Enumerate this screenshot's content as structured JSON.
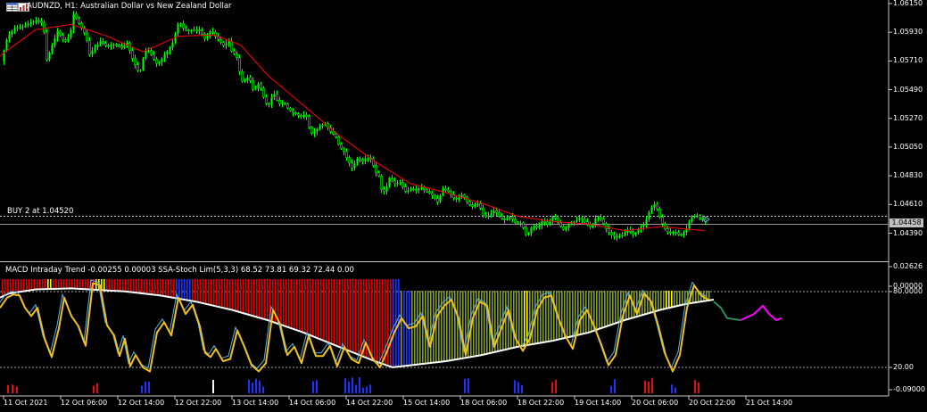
{
  "header": {
    "symbol": "AUDNZD",
    "timeframe": "H1",
    "description": "Australian Dollar vs New Zealand Dollar",
    "text": "AUDNZD, H1:  Australian Dollar vs New Zealand Dollar"
  },
  "icons": {
    "left": "grid-icon",
    "right": "chart-bars-icon"
  },
  "order_line": {
    "label": "BUY 2 at 1.04520",
    "price": 1.0452
  },
  "current_price": {
    "label": "1.04458",
    "value": 1.04458
  },
  "indicator": {
    "title": "MACD Intraday Trend -0.00255 0.00003 SSA-Stoch Lim(5,3,3) 68.52 73.81 69.32 72.44 0.00"
  },
  "colors": {
    "background": "#000000",
    "bull_candle": "#00ff00",
    "moving_average": "#ff0000",
    "hist_bearish": "#e00000",
    "hist_bullish": "#7f9a2e",
    "hist_neutral_yellow": "#ffff00",
    "hist_blue": "#1e32ff",
    "stoch_main": "#f0c020",
    "stoch_signal": "#5ab4e6",
    "trend_line": "#ffffff",
    "forecast_magenta": "#ff00ff",
    "forecast_green": "#2e8b57",
    "grid_dashed": "#aaaaaa"
  },
  "chart_data": [
    {
      "type": "candlestick",
      "title": "AUDNZD, H1",
      "price_axis_ticks": [
        "1.06150",
        "1.05930",
        "1.05710",
        "1.05490",
        "1.05270",
        "1.05050",
        "1.04830",
        "1.04610",
        "1.04390"
      ],
      "ylim": [
        1.0425,
        1.0615
      ],
      "time_axis_ticks": [
        "11 Oct 2021",
        "12 Oct 06:00",
        "12 Oct 14:00",
        "12 Oct 22:00",
        "13 Oct 14:00",
        "14 Oct 06:00",
        "14 Oct 22:00",
        "15 Oct 14:00",
        "18 Oct 06:00",
        "18 Oct 22:00",
        "19 Oct 14:00",
        "20 Oct 06:00",
        "20 Oct 22:00",
        "21 Oct 14:00"
      ],
      "close_path": [
        [
          0,
          1.0568
        ],
        [
          8,
          1.059
        ],
        [
          16,
          1.0596
        ],
        [
          24,
          1.0597
        ],
        [
          32,
          1.06
        ],
        [
          40,
          1.0602
        ],
        [
          48,
          1.06
        ],
        [
          52,
          1.0572
        ],
        [
          58,
          1.0583
        ],
        [
          64,
          1.0594
        ],
        [
          72,
          1.0585
        ],
        [
          78,
          1.0591
        ],
        [
          82,
          1.0607
        ],
        [
          88,
          1.06
        ],
        [
          96,
          1.059
        ],
        [
          100,
          1.0576
        ],
        [
          104,
          1.058
        ],
        [
          112,
          1.0586
        ],
        [
          120,
          1.0582
        ],
        [
          128,
          1.0584
        ],
        [
          136,
          1.0581
        ],
        [
          142,
          1.0585
        ],
        [
          148,
          1.0573
        ],
        [
          151,
          1.0568
        ],
        [
          156,
          1.0561
        ],
        [
          160,
          1.0573
        ],
        [
          164,
          1.0581
        ],
        [
          168,
          1.0577
        ],
        [
          176,
          1.0568
        ],
        [
          184,
          1.0576
        ],
        [
          192,
          1.0583
        ],
        [
          196,
          1.0592
        ],
        [
          200,
          1.0602
        ],
        [
          206,
          1.0595
        ],
        [
          212,
          1.0594
        ],
        [
          218,
          1.0595
        ],
        [
          224,
          1.0594
        ],
        [
          230,
          1.0587
        ],
        [
          236,
          1.0595
        ],
        [
          242,
          1.0589
        ],
        [
          250,
          1.0583
        ],
        [
          256,
          1.0586
        ],
        [
          260,
          1.0576
        ],
        [
          264,
          1.0577
        ],
        [
          268,
          1.0563
        ],
        [
          272,
          1.0553
        ],
        [
          276,
          1.0559
        ],
        [
          280,
          1.0556
        ],
        [
          284,
          1.0547
        ],
        [
          290,
          1.0555
        ],
        [
          296,
          1.0541
        ],
        [
          300,
          1.0536
        ],
        [
          306,
          1.0547
        ],
        [
          312,
          1.0538
        ],
        [
          318,
          1.0539
        ],
        [
          322,
          1.0535
        ],
        [
          326,
          1.0532
        ],
        [
          332,
          1.053
        ],
        [
          338,
          1.0528
        ],
        [
          342,
          1.0531
        ],
        [
          348,
          1.0515
        ],
        [
          354,
          1.0518
        ],
        [
          358,
          1.0521
        ],
        [
          364,
          1.0523
        ],
        [
          370,
          1.0517
        ],
        [
          376,
          1.0513
        ],
        [
          380,
          1.0505
        ],
        [
          384,
          1.0503
        ],
        [
          390,
          1.0494
        ],
        [
          394,
          1.0489
        ],
        [
          400,
          1.0496
        ],
        [
          406,
          1.0494
        ],
        [
          410,
          1.0497
        ],
        [
          416,
          1.0496
        ],
        [
          420,
          1.0486
        ],
        [
          424,
          1.0483
        ],
        [
          428,
          1.0469
        ],
        [
          432,
          1.0473
        ],
        [
          436,
          1.0481
        ],
        [
          442,
          1.0477
        ],
        [
          448,
          1.0478
        ],
        [
          454,
          1.0471
        ],
        [
          460,
          1.0473
        ],
        [
          466,
          1.0472
        ],
        [
          472,
          1.0474
        ],
        [
          478,
          1.0471
        ],
        [
          484,
          1.0468
        ],
        [
          490,
          1.0463
        ],
        [
          496,
          1.0473
        ],
        [
          502,
          1.0471
        ],
        [
          508,
          1.0466
        ],
        [
          512,
          1.0465
        ],
        [
          518,
          1.0469
        ],
        [
          524,
          1.0462
        ],
        [
          530,
          1.0459
        ],
        [
          536,
          1.0462
        ],
        [
          542,
          1.0451
        ],
        [
          548,
          1.0453
        ],
        [
          554,
          1.0457
        ],
        [
          560,
          1.0451
        ],
        [
          566,
          1.0449
        ],
        [
          572,
          1.0452
        ],
        [
          578,
          1.0446
        ],
        [
          584,
          1.0447
        ],
        [
          590,
          1.0436
        ],
        [
          596,
          1.0445
        ],
        [
          602,
          1.0443
        ],
        [
          608,
          1.0449
        ],
        [
          614,
          1.0445
        ],
        [
          620,
          1.0453
        ],
        [
          626,
          1.0446
        ],
        [
          632,
          1.0441
        ],
        [
          638,
          1.0447
        ],
        [
          644,
          1.0448
        ],
        [
          650,
          1.0451
        ],
        [
          656,
          1.0447
        ],
        [
          662,
          1.0443
        ],
        [
          668,
          1.0452
        ],
        [
          674,
          1.0449
        ],
        [
          680,
          1.0441
        ],
        [
          686,
          1.0437
        ],
        [
          692,
          1.0436
        ],
        [
          698,
          1.0438
        ],
        [
          704,
          1.0442
        ],
        [
          710,
          1.0437
        ],
        [
          716,
          1.0443
        ],
        [
          722,
          1.0446
        ],
        [
          728,
          1.0457
        ],
        [
          734,
          1.0462
        ],
        [
          740,
          1.0449
        ],
        [
          746,
          1.0441
        ],
        [
          750,
          1.0439
        ],
        [
          756,
          1.044
        ],
        [
          762,
          1.0437
        ],
        [
          768,
          1.0441
        ],
        [
          774,
          1.0451
        ],
        [
          780,
          1.0453
        ],
        [
          786,
          1.045
        ],
        [
          790,
          1.0448
        ]
      ],
      "ma_path": [
        [
          0,
          1.0575
        ],
        [
          40,
          1.0595
        ],
        [
          80,
          1.0599
        ],
        [
          120,
          1.059
        ],
        [
          160,
          1.0578
        ],
        [
          200,
          1.059
        ],
        [
          240,
          1.0591
        ],
        [
          270,
          1.0583
        ],
        [
          300,
          1.056
        ],
        [
          340,
          1.0537
        ],
        [
          380,
          1.0514
        ],
        [
          420,
          1.0494
        ],
        [
          460,
          1.0477
        ],
        [
          500,
          1.047
        ],
        [
          540,
          1.0462
        ],
        [
          580,
          1.0452
        ],
        [
          620,
          1.0448
        ],
        [
          660,
          1.0446
        ],
        [
          700,
          1.0441
        ],
        [
          740,
          1.0444
        ],
        [
          790,
          1.0441
        ]
      ]
    },
    {
      "type": "indicator",
      "title": "MACD Intraday Trend / SSA-Stoch Lim(5,3,3)",
      "axis_ticks": [
        "0.02626",
        "0.00000",
        "80.0000",
        "20.00",
        "-0.09000"
      ],
      "levels": [
        80,
        20
      ],
      "stoch_main": [
        [
          0,
          72
        ],
        [
          8,
          82
        ],
        [
          15,
          85
        ],
        [
          22,
          84
        ],
        [
          28,
          72
        ],
        [
          35,
          64
        ],
        [
          42,
          72
        ],
        [
          50,
          42
        ],
        [
          58,
          24
        ],
        [
          66,
          52
        ],
        [
          72,
          82
        ],
        [
          80,
          64
        ],
        [
          88,
          54
        ],
        [
          96,
          35
        ],
        [
          104,
          96
        ],
        [
          112,
          94
        ],
        [
          120,
          55
        ],
        [
          128,
          45
        ],
        [
          134,
          25
        ],
        [
          140,
          42
        ],
        [
          146,
          15
        ],
        [
          152,
          26
        ],
        [
          160,
          14
        ],
        [
          168,
          10
        ],
        [
          176,
          48
        ],
        [
          184,
          58
        ],
        [
          192,
          45
        ],
        [
          200,
          82
        ],
        [
          208,
          66
        ],
        [
          216,
          75
        ],
        [
          224,
          54
        ],
        [
          230,
          28
        ],
        [
          236,
          24
        ],
        [
          242,
          32
        ],
        [
          250,
          20
        ],
        [
          258,
          22
        ],
        [
          266,
          50
        ],
        [
          274,
          34
        ],
        [
          282,
          16
        ],
        [
          290,
          10
        ],
        [
          298,
          18
        ],
        [
          306,
          70
        ],
        [
          314,
          56
        ],
        [
          322,
          26
        ],
        [
          330,
          34
        ],
        [
          338,
          18
        ],
        [
          346,
          45
        ],
        [
          354,
          25
        ],
        [
          362,
          25
        ],
        [
          370,
          35
        ],
        [
          378,
          15
        ],
        [
          386,
          34
        ],
        [
          394,
          22
        ],
        [
          402,
          18
        ],
        [
          410,
          38
        ],
        [
          418,
          22
        ],
        [
          426,
          14
        ],
        [
          434,
          30
        ],
        [
          442,
          48
        ],
        [
          450,
          62
        ],
        [
          458,
          52
        ],
        [
          466,
          54
        ],
        [
          474,
          64
        ],
        [
          482,
          34
        ],
        [
          490,
          64
        ],
        [
          498,
          74
        ],
        [
          506,
          80
        ],
        [
          514,
          62
        ],
        [
          522,
          26
        ],
        [
          530,
          62
        ],
        [
          538,
          78
        ],
        [
          546,
          74
        ],
        [
          554,
          34
        ],
        [
          562,
          52
        ],
        [
          570,
          70
        ],
        [
          578,
          42
        ],
        [
          586,
          30
        ],
        [
          594,
          42
        ],
        [
          602,
          70
        ],
        [
          610,
          82
        ],
        [
          618,
          84
        ],
        [
          626,
          62
        ],
        [
          634,
          44
        ],
        [
          642,
          32
        ],
        [
          650,
          60
        ],
        [
          658,
          70
        ],
        [
          666,
          54
        ],
        [
          674,
          36
        ],
        [
          682,
          16
        ],
        [
          690,
          26
        ],
        [
          698,
          64
        ],
        [
          706,
          84
        ],
        [
          714,
          66
        ],
        [
          722,
          86
        ],
        [
          730,
          78
        ],
        [
          738,
          54
        ],
        [
          746,
          26
        ],
        [
          754,
          10
        ],
        [
          762,
          26
        ],
        [
          770,
          72
        ],
        [
          778,
          94
        ],
        [
          786,
          84
        ],
        [
          794,
          80
        ]
      ],
      "trend_line": [
        [
          0,
          82
        ],
        [
          10,
          86
        ],
        [
          40,
          90
        ],
        [
          80,
          91
        ],
        [
          100,
          90
        ],
        [
          140,
          88
        ],
        [
          180,
          84
        ],
        [
          220,
          78
        ],
        [
          260,
          70
        ],
        [
          300,
          60
        ],
        [
          340,
          48
        ],
        [
          380,
          34
        ],
        [
          420,
          20
        ],
        [
          440,
          14
        ],
        [
          460,
          16
        ],
        [
          500,
          20
        ],
        [
          540,
          26
        ],
        [
          580,
          34
        ],
        [
          620,
          40
        ],
        [
          660,
          48
        ],
        [
          700,
          60
        ],
        [
          740,
          70
        ],
        [
          770,
          76
        ],
        [
          800,
          80
        ]
      ],
      "forecast": [
        [
          800,
          78
        ],
        [
          808,
          72
        ],
        [
          815,
          62
        ],
        [
          830,
          60
        ],
        [
          845,
          66
        ],
        [
          855,
          74
        ],
        [
          862,
          66
        ],
        [
          870,
          60
        ],
        [
          876,
          62
        ]
      ]
    }
  ]
}
